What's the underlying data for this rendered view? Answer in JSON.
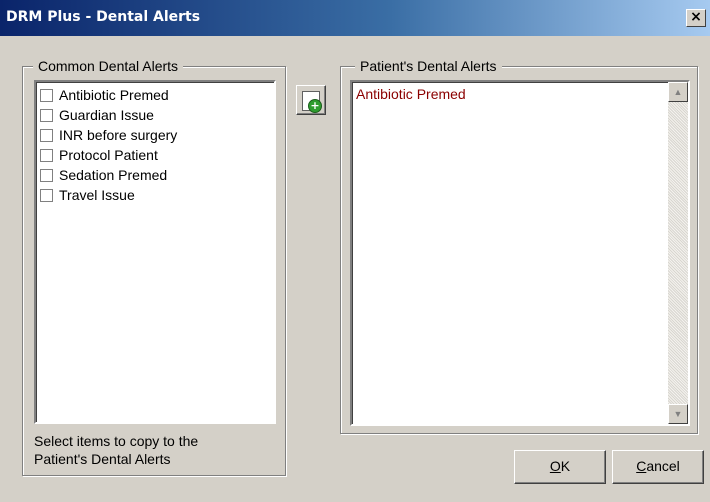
{
  "window": {
    "title": "DRM Plus - Dental Alerts",
    "close_glyph": "×"
  },
  "common_alerts": {
    "legend": "Common Dental Alerts",
    "items": [
      {
        "label": "Antibiotic Premed",
        "checked": false
      },
      {
        "label": "Guardian Issue",
        "checked": false
      },
      {
        "label": "INR before surgery",
        "checked": false
      },
      {
        "label": "Protocol Patient",
        "checked": false
      },
      {
        "label": "Sedation Premed",
        "checked": false
      },
      {
        "label": "Travel Issue",
        "checked": false
      }
    ],
    "hint_line1": "Select items to copy to the",
    "hint_line2": "Patient's Dental Alerts"
  },
  "copy_button": {
    "icon": "add-document-icon",
    "plus_glyph": "+"
  },
  "patient_alerts": {
    "legend": "Patient's Dental Alerts",
    "items": [
      "Antibiotic Premed"
    ],
    "item_color": "#8b0000",
    "scroll_up_glyph": "▲",
    "scroll_down_glyph": "▼"
  },
  "buttons": {
    "ok_mnemonic": "O",
    "ok_rest": "K",
    "cancel_mnemonic": "C",
    "cancel_rest": "ancel"
  }
}
